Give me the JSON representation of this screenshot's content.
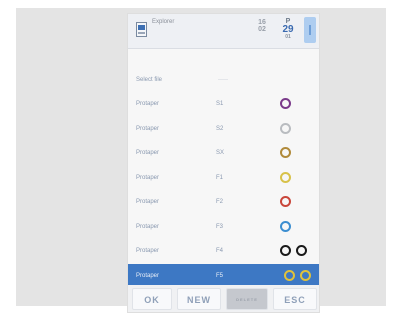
{
  "header": {
    "title": "Explorer",
    "speed_top": "16",
    "speed_bottom": "02",
    "count_top": "P",
    "count_value": "29",
    "count_sub": "01"
  },
  "select": {
    "label": "Select file",
    "value": "-----"
  },
  "rows": [
    {
      "name": "Protaper",
      "code": "S1",
      "colors": [
        "#7a3a8a"
      ]
    },
    {
      "name": "Protaper",
      "code": "S2",
      "colors": [
        "#b9bcc0"
      ]
    },
    {
      "name": "Protaper",
      "code": "SX",
      "colors": [
        "#b08a3a"
      ]
    },
    {
      "name": "Protaper",
      "code": "F1",
      "colors": [
        "#d8c24a"
      ]
    },
    {
      "name": "Protaper",
      "code": "F2",
      "colors": [
        "#c9463a"
      ]
    },
    {
      "name": "Protaper",
      "code": "F3",
      "colors": [
        "#3c8ed0"
      ]
    },
    {
      "name": "Protaper",
      "code": "F4",
      "colors": [
        "#1a1a1a",
        "#1a1a1a"
      ]
    },
    {
      "name": "Protaper",
      "code": "F5",
      "colors": [
        "#e0c23a",
        "#e0c23a"
      ],
      "selected": true
    }
  ],
  "footer": {
    "ok": "OK",
    "new": "NEW",
    "delete": "DELETE",
    "esc": "ESC"
  }
}
